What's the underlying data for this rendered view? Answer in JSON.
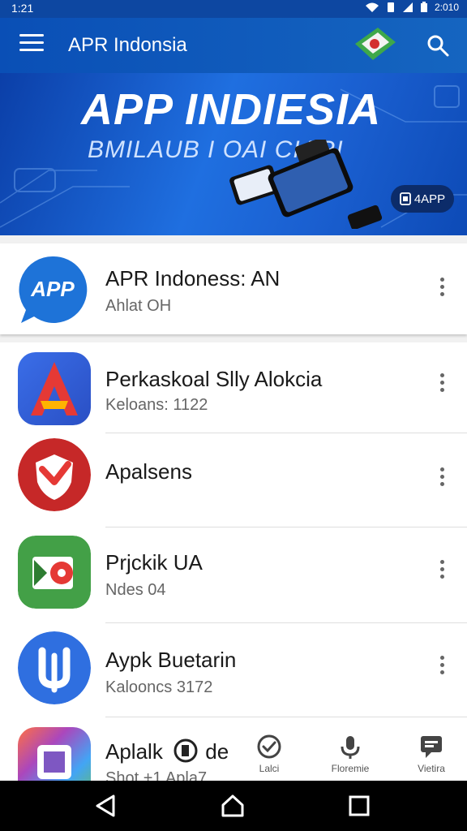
{
  "status_bar": {
    "time": "1:21",
    "battery_text": "2:010"
  },
  "app_bar": {
    "title": "APR Indonsia"
  },
  "banner": {
    "title": "APP INDIESIA",
    "subtitle": "BMILAUB I OAI CIARI",
    "badge_label": "4APP"
  },
  "featured": {
    "icon_text": "APP",
    "name": "APR Indoness: AN",
    "subtitle": "Ahlat OH",
    "icon_color": "#1e73d8"
  },
  "apps": [
    {
      "name": "Perkaskoal Slly Alokcia",
      "subtitle": "Keloans: 1122"
    },
    {
      "name": "Apalsens",
      "subtitle": ""
    },
    {
      "name": "Prjckik UA",
      "subtitle": "Ndes 04"
    },
    {
      "name": "Aypk Buetarin",
      "subtitle": "Kalooncs 3172"
    },
    {
      "name": "Aplalk",
      "name_suffix": "de",
      "subtitle": "Shot  +1  Apla7"
    }
  ],
  "bottom_tabs": [
    {
      "label": "Lalci",
      "icon": "check-circle-icon"
    },
    {
      "label": "Floremie",
      "icon": "microphone-icon"
    },
    {
      "label": "Vietira",
      "icon": "chat-icon"
    }
  ],
  "colors": {
    "accent": "#1565c0",
    "status_bar": "#0d47a1",
    "nav_bar": "#000000"
  }
}
